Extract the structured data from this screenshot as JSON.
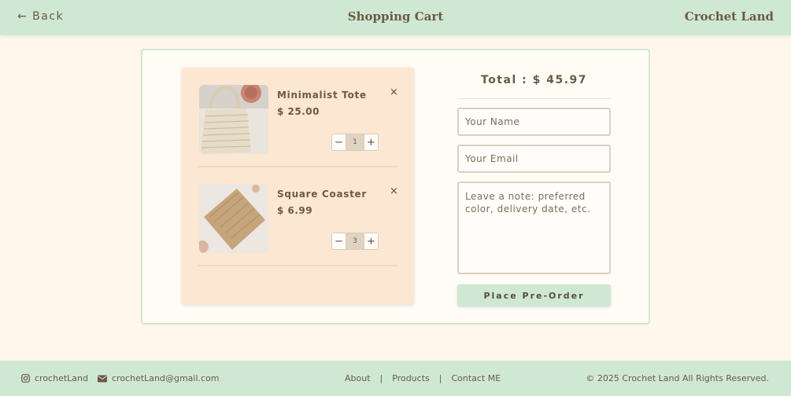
{
  "header": {
    "back_label": "← Back",
    "title": "Shopping Cart",
    "brand": "Crochet Land"
  },
  "cart": {
    "items": [
      {
        "name": "Minimalist Tote",
        "price": "$ 25.00",
        "quantity": "1",
        "remove": "×",
        "decrement": "−",
        "increment": "+",
        "thumb_icon": "tote-bag-image"
      },
      {
        "name": "Square Coaster",
        "price": "$ 6.99",
        "quantity": "3",
        "remove": "×",
        "decrement": "−",
        "increment": "+",
        "thumb_icon": "coaster-image"
      }
    ]
  },
  "checkout": {
    "total": "Total : $ 45.97",
    "name_placeholder": "Your Name",
    "email_placeholder": "Your Email",
    "note_placeholder": "Leave a note: preferred color, delivery date, etc.",
    "button_label": "Place Pre-Order"
  },
  "footer": {
    "instagram": "crochetLand",
    "email": "crochetLand@gmail.com",
    "links": [
      "About",
      "Products",
      "Contact ME"
    ],
    "separator": "|",
    "copyright": "© 2025 Crochet Land All Rights Reserved."
  },
  "colors": {
    "mint": "#cfe8d3",
    "background": "#fff6ec",
    "cart_background": "#fce7d2",
    "text": "#6b5a45"
  }
}
